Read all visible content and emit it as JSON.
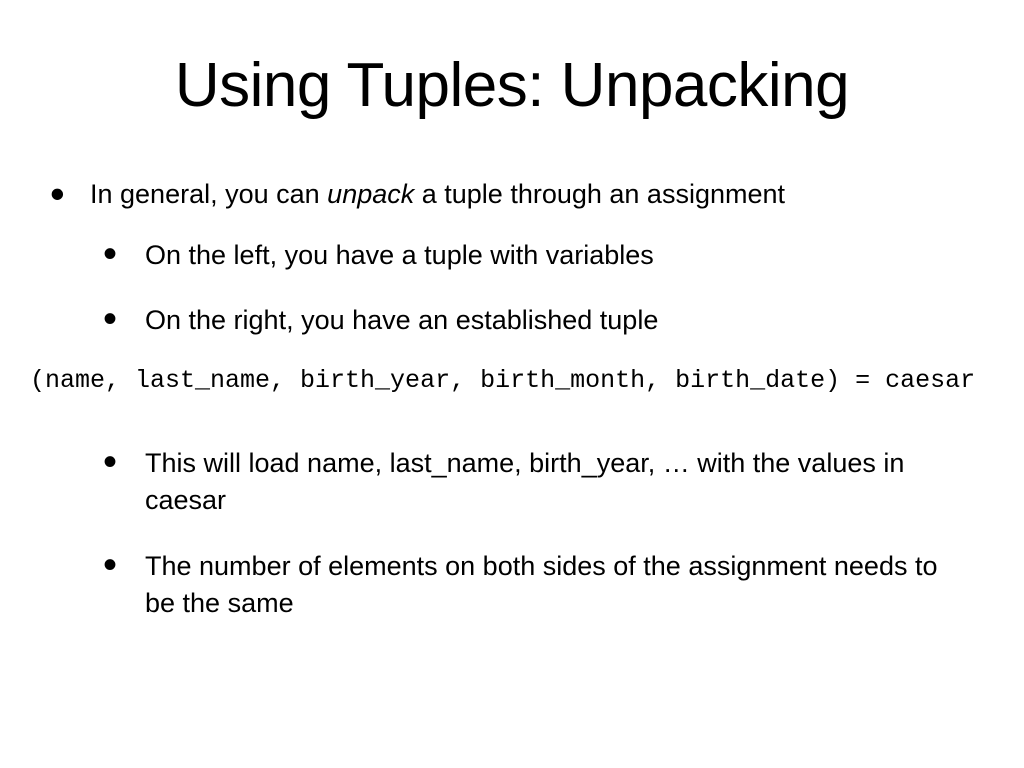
{
  "title": "Using Tuples: Unpacking",
  "bullets": {
    "p1_before": "In general, you can ",
    "p1_em": "unpack",
    "p1_after": " a tuple through an assignment",
    "sub1a": "On the left, you have a tuple with variables",
    "sub1b": "On the right, you have an established tuple",
    "code": "(name, last_name, birth_year, birth_month, birth_date) = caesar",
    "sub2a": "This will load name, last_name, birth_year, … with the values in caesar",
    "sub2b": "The number of elements on both sides of the assignment needs to be the same"
  }
}
